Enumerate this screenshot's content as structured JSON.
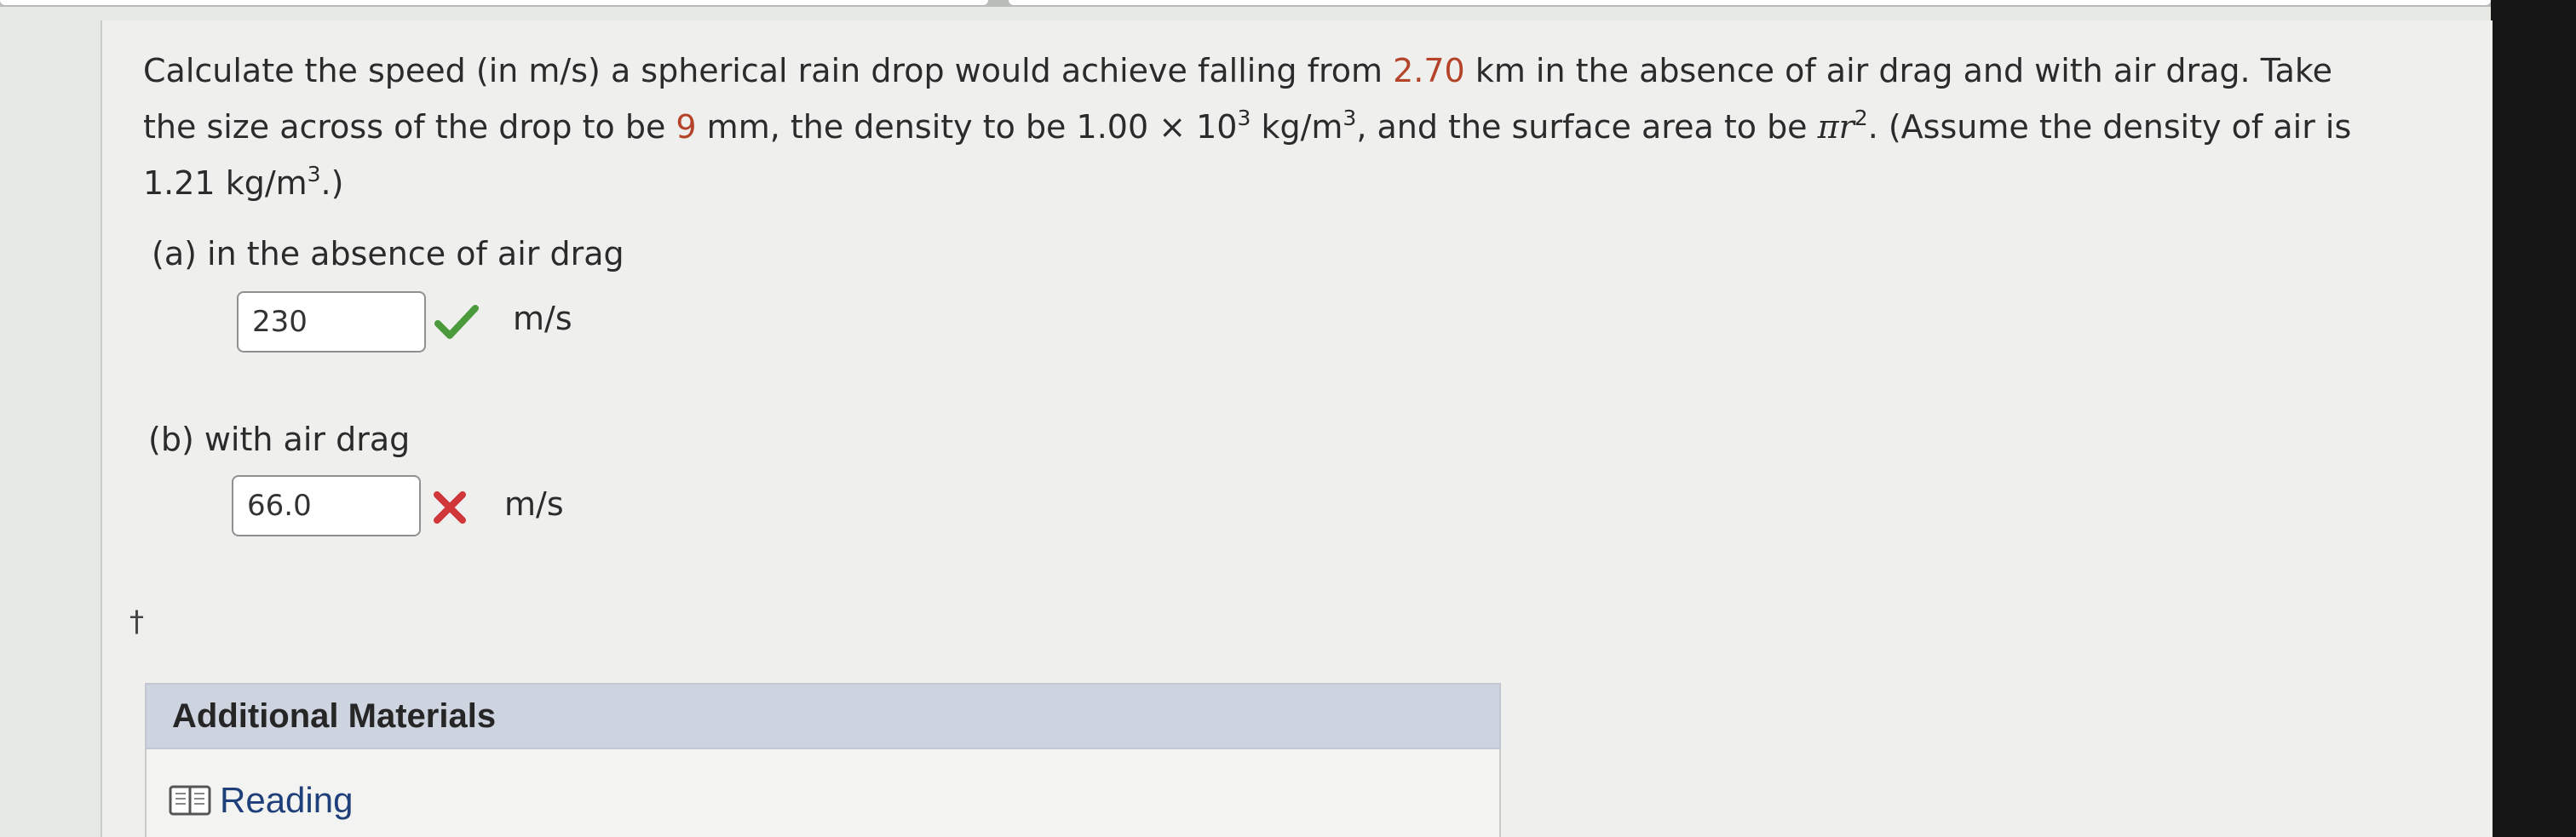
{
  "question": {
    "p1": "Calculate the speed (in m/s) a spherical rain drop would achieve falling from ",
    "height": "2.70",
    "p2": " km in the absence of air drag and with air drag. Take the size across of the drop to be ",
    "size": "9",
    "p3": " mm, the density to be 1.00 × 10",
    "exp3": "3",
    "p4": " kg/m",
    "exp3b": "3",
    "p5": ", and the surface area to be ",
    "pi_r": "πr",
    "exp2": "2",
    "p6": ". (Assume the density of air is 1.21 kg/m",
    "exp3c": "3",
    "p7": ".)"
  },
  "part_a": {
    "label": "(a)   in the absence of air drag",
    "value": "230",
    "unit": "m/s",
    "status": "correct"
  },
  "part_b": {
    "label": "(b)   with air drag",
    "value": "66.0",
    "unit": "m/s",
    "status": "incorrect"
  },
  "dagger": "†",
  "additional_materials": {
    "title": "Additional Materials",
    "reading": "Reading"
  },
  "colors": {
    "highlight": "#b5432a",
    "correct": "#4b9a3b",
    "incorrect": "#d0363a",
    "link": "#1f3f7a",
    "header_bg": "#cdd3df"
  }
}
